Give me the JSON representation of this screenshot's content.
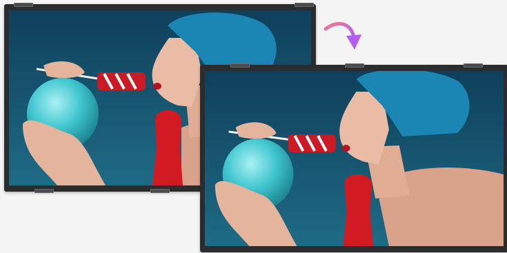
{
  "scene": {
    "description_free": true,
    "colors": {
      "background": "#f4f4f5",
      "bezel": "#2b2c2e",
      "sky_top": "#0f3f5a",
      "sky_bottom": "#1f6b86",
      "cap": "#1b86b3",
      "skin": "#e8b9a2",
      "ball": "#41c6cf",
      "red": "#d21a22",
      "arrow_start": "#f07a8c",
      "arrow_end": "#b45cf0"
    },
    "icons": [
      "rotate-arrow-icon"
    ]
  }
}
